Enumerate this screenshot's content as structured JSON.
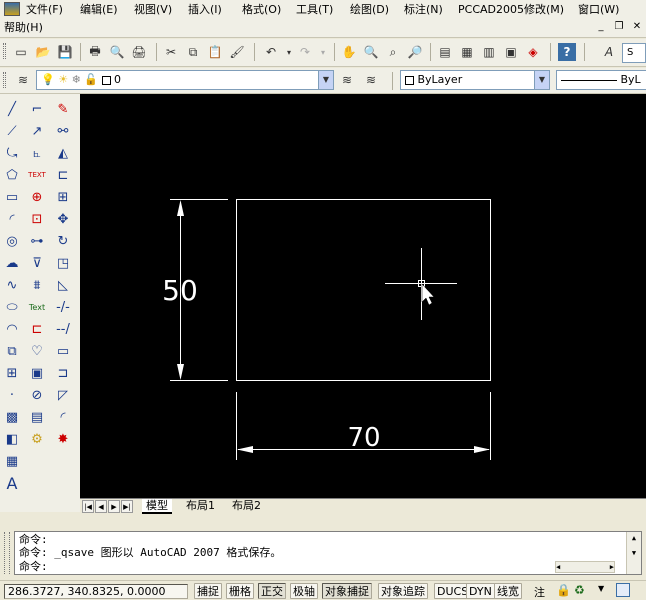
{
  "menu": {
    "items": [
      "文件(F)",
      "编辑(E)",
      "视图(V)",
      "插入(I)",
      "格式(O)",
      "工具(T)",
      "绘图(D)",
      "标注(N)",
      "PCCAD2005",
      "修改(M)",
      "窗口(W)",
      "帮助(H)"
    ]
  },
  "layer_toolbar": {
    "layer_value": "0",
    "color_value": "ByLayer",
    "linetype_value": "ByL"
  },
  "drawing": {
    "height_dim": "50",
    "width_dim": "70"
  },
  "tabs": [
    "模型",
    "布局1",
    "布局2"
  ],
  "command": {
    "lines": [
      "命令:",
      "命令: _qsave 图形以 AutoCAD 2007 格式保存。",
      "命令:"
    ]
  },
  "status": {
    "coords": "286.3727, 340.8325, 0.0000",
    "toggles": [
      "捕捉",
      "栅格",
      "正交",
      "极轴",
      "对象捕捉",
      "对象追踪",
      "DUCS",
      "DYN",
      "线宽"
    ],
    "extra": "注"
  }
}
